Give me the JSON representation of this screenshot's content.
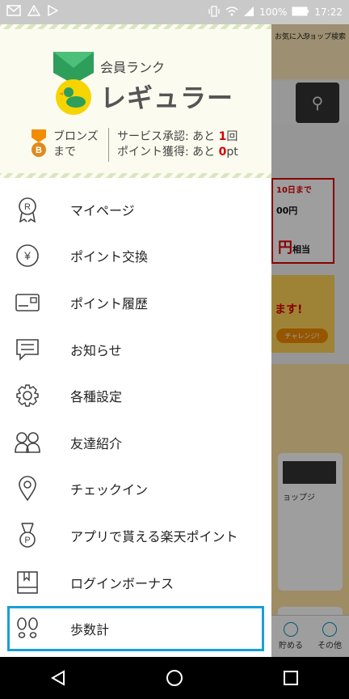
{
  "status_bar": {
    "battery_text": "100%",
    "time": "17:22"
  },
  "background": {
    "header_fav": "お気に入り",
    "header_shop": "ショップ検索",
    "banner1_top": "10日まで",
    "banner1_mid": "00円",
    "banner1_sub": "相当",
    "banner1_big": "円",
    "banner2_text": "ます!",
    "banner2_pill": "チャレンジ!",
    "panel_label": "ョップジ",
    "footer_save": "貯める",
    "footer_other": "その他"
  },
  "rank": {
    "label": "会員ランク",
    "name": "レギュラー",
    "next_rank_line1": "ブロンズ",
    "next_rank_line2": "まで",
    "service_prefix": "サービス承認: あと ",
    "service_value": "1",
    "service_suffix": "回",
    "point_prefix": "ポイント獲得: あと ",
    "point_value": "0",
    "point_suffix": "pt",
    "bronze_badge_letter": "B"
  },
  "menu": [
    {
      "label": "マイページ",
      "icon": "ribbon-r-icon"
    },
    {
      "label": "ポイント交換",
      "icon": "yen-coin-icon"
    },
    {
      "label": "ポイント履歴",
      "icon": "card-icon"
    },
    {
      "label": "お知らせ",
      "icon": "message-icon"
    },
    {
      "label": "各種設定",
      "icon": "gear-icon"
    },
    {
      "label": "友達紹介",
      "icon": "friends-icon"
    },
    {
      "label": "チェックイン",
      "icon": "location-pin-icon"
    },
    {
      "label": "アプリで貰える楽天ポイント",
      "icon": "medal-p-icon"
    },
    {
      "label": "ログインボーナス",
      "icon": "book-icon"
    },
    {
      "label": "歩数計",
      "icon": "footprints-icon"
    }
  ],
  "colors": {
    "accent_selected": "#1a9fd6",
    "highlight_red": "#d40000"
  }
}
